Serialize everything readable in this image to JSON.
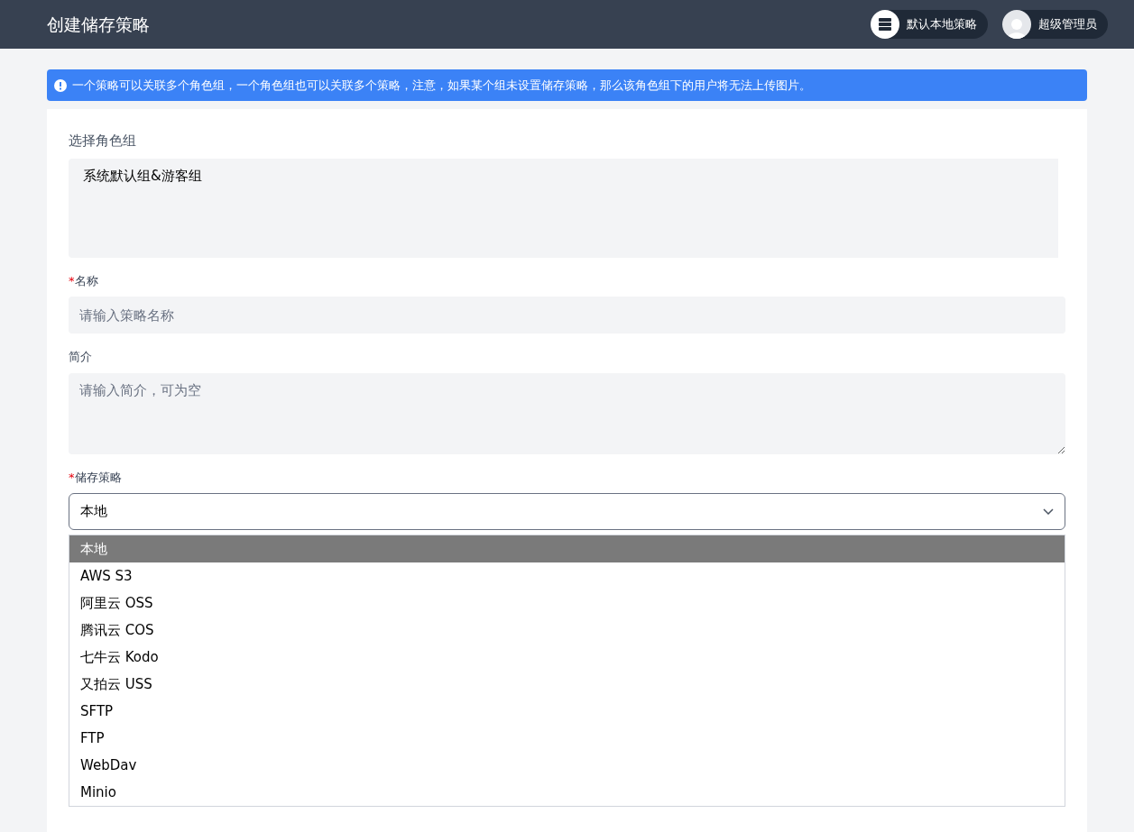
{
  "header": {
    "title": "创建储存策略",
    "policy_chip": "默认本地策略",
    "user_chip": "超级管理员"
  },
  "alert": {
    "text": "一个策略可以关联多个角色组，一个角色组也可以关联多个策略，注意，如果某个组未设置储存策略，那么该角色组下的用户将无法上传图片。"
  },
  "form": {
    "group_label": "选择角色组",
    "groups": [
      "系统默认组&游客组"
    ],
    "name_label": "名称",
    "name_required_mark": "*",
    "name_placeholder": "请输入策略名称",
    "intro_label": "简介",
    "intro_placeholder": "请输入简介，可为空",
    "storage_label": "储存策略",
    "storage_required_mark": "*",
    "storage_value": "本地",
    "storage_options": [
      {
        "label": "本地",
        "selected": true
      },
      {
        "label": "AWS S3",
        "selected": false
      },
      {
        "label": "阿里云 OSS",
        "selected": false
      },
      {
        "label": "腾讯云 COS",
        "selected": false
      },
      {
        "label": "七牛云 Kodo",
        "selected": false
      },
      {
        "label": "又拍云 USS",
        "selected": false
      },
      {
        "label": "SFTP",
        "selected": false
      },
      {
        "label": "FTP",
        "selected": false
      },
      {
        "label": "WebDav",
        "selected": false
      },
      {
        "label": "Minio",
        "selected": false
      }
    ]
  }
}
